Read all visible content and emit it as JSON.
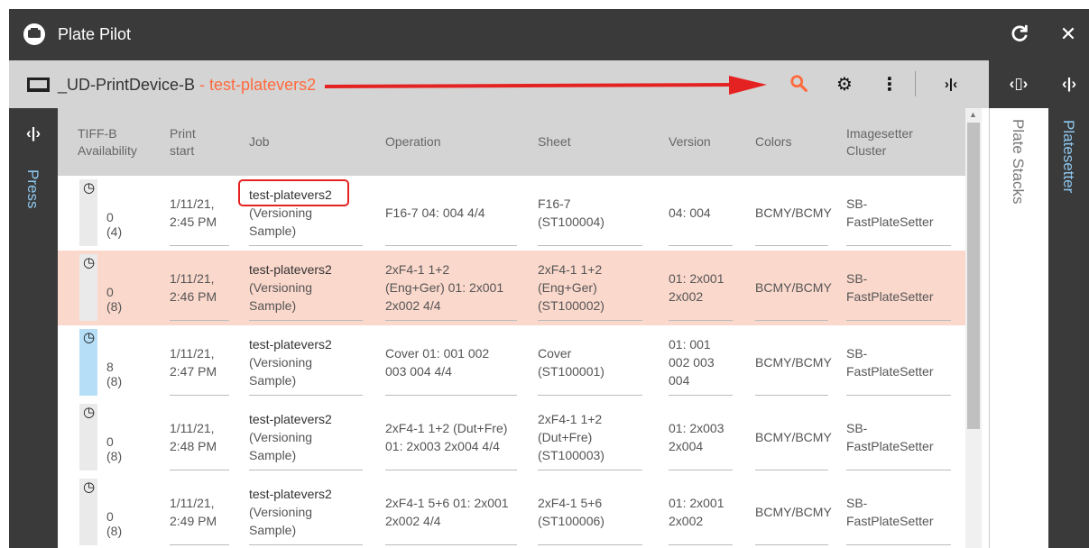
{
  "app": {
    "title": "Plate Pilot"
  },
  "toolbar": {
    "device": "_UD-PrintDevice-B",
    "separator": " - ",
    "job": "test-platevers2"
  },
  "panes": {
    "left": "Press",
    "right1": "Plate Stacks",
    "right2": "Platesetter"
  },
  "colors": {
    "titlebar": "#3a3a3a",
    "toolbar": "#d4d4d4",
    "accent": "#ff6a3d",
    "highlight_row": "#fbd8cc",
    "annotation": "#e52222"
  },
  "icons": [
    "app-logo-icon",
    "refresh-icon",
    "close-icon",
    "device-icon",
    "search-icon",
    "gear-icon",
    "more-vertical-icon",
    "collapse-icon",
    "expand-icon"
  ],
  "table": {
    "columns": [
      "TIFF-B Availability",
      "Print start",
      "Job",
      "Operation",
      "Sheet",
      "Version",
      "Colors",
      "Imagesetter Cluster"
    ],
    "column_lines": [
      [
        "TIFF-B",
        "Availability"
      ],
      [
        "Print",
        "start"
      ],
      [
        "Job"
      ],
      [
        "Operation"
      ],
      [
        "Sheet"
      ],
      [
        "Version"
      ],
      [
        "Colors"
      ],
      [
        "Imagesetter",
        "Cluster"
      ]
    ],
    "rows": [
      {
        "availability": "0 (4)",
        "available": false,
        "print_start": [
          "1/11/21,",
          "2:45 PM"
        ],
        "job": [
          "test-platevers2",
          "(Versioning",
          "Sample)"
        ],
        "operation": [
          "F16-7 04: 004 4/4"
        ],
        "sheet": [
          "F16-7",
          "(ST100004)"
        ],
        "version": [
          "04: 004"
        ],
        "colors": "BCMY/BCMY",
        "cluster": [
          "SB-",
          "FastPlateSetter"
        ]
      },
      {
        "availability": "0 (8)",
        "available": false,
        "print_start": [
          "1/11/21,",
          "2:46 PM"
        ],
        "job": [
          "test-platevers2",
          "(Versioning",
          "Sample)"
        ],
        "operation": [
          "2xF4-1 1+2",
          "(Eng+Ger) 01: 2x001",
          "2x002 4/4"
        ],
        "sheet": [
          "2xF4-1 1+2",
          "(Eng+Ger)",
          "(ST100002)"
        ],
        "version": [
          "01: 2x001",
          "2x002"
        ],
        "colors": "BCMY/BCMY",
        "cluster": [
          "SB-",
          "FastPlateSetter"
        ]
      },
      {
        "availability": "8 (8)",
        "available": true,
        "print_start": [
          "1/11/21,",
          "2:47 PM"
        ],
        "job": [
          "test-platevers2",
          "(Versioning",
          "Sample)"
        ],
        "operation": [
          "Cover 01: 001 002",
          "003 004 4/4"
        ],
        "sheet": [
          "Cover",
          "(ST100001)"
        ],
        "version": [
          "01: 001",
          "002 003",
          "004"
        ],
        "colors": "BCMY/BCMY",
        "cluster": [
          "SB-",
          "FastPlateSetter"
        ]
      },
      {
        "availability": "0 (8)",
        "available": false,
        "print_start": [
          "1/11/21,",
          "2:48 PM"
        ],
        "job": [
          "test-platevers2",
          "(Versioning",
          "Sample)"
        ],
        "operation": [
          "2xF4-1 1+2 (Dut+Fre)",
          "01: 2x003 2x004 4/4"
        ],
        "sheet": [
          "2xF4-1 1+2",
          "(Dut+Fre)",
          "(ST100003)"
        ],
        "version": [
          "01: 2x003",
          "2x004"
        ],
        "colors": "BCMY/BCMY",
        "cluster": [
          "SB-",
          "FastPlateSetter"
        ]
      },
      {
        "availability": "0 (8)",
        "available": false,
        "print_start": [
          "1/11/21,",
          "2:49 PM"
        ],
        "job": [
          "test-platevers2",
          "(Versioning",
          "Sample)"
        ],
        "operation": [
          "2xF4-1 5+6 01: 2x001",
          "2x002 4/4"
        ],
        "sheet": [
          "2xF4-1 5+6",
          "(ST100006)"
        ],
        "version": [
          "01: 2x001",
          "2x002"
        ],
        "colors": "BCMY/BCMY",
        "cluster": [
          "SB-",
          "FastPlateSetter"
        ]
      }
    ]
  }
}
